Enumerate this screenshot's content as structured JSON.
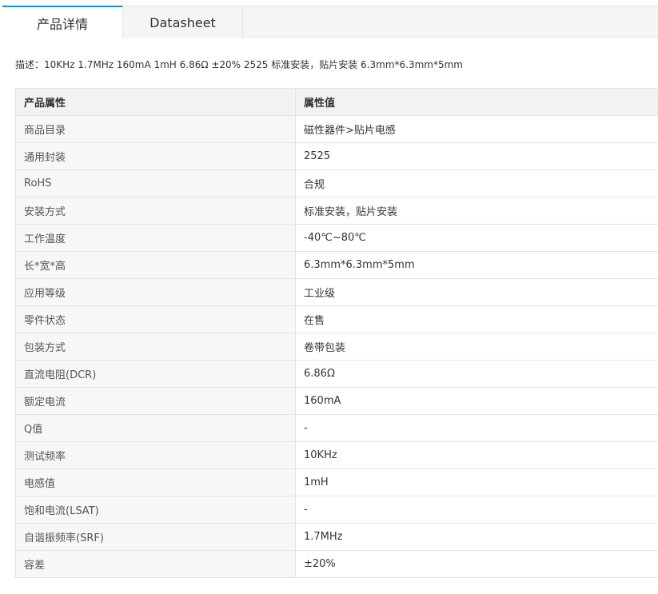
{
  "tabs": [
    {
      "label": "产品详情",
      "active": true
    },
    {
      "label": "Datasheet",
      "active": false
    }
  ],
  "description": "描述：10KHz 1.7MHz 160mA 1mH 6.86Ω ±20% 2525 标准安装，贴片安装 6.3mm*6.3mm*5mm",
  "table": {
    "headers": [
      "产品属性",
      "属性值"
    ],
    "rows": [
      {
        "name": "商品目录",
        "value": "磁性器件>贴片电感"
      },
      {
        "name": "通用封装",
        "value": "2525"
      },
      {
        "name": "RoHS",
        "value": "合规"
      },
      {
        "name": "安装方式",
        "value": "标准安装，贴片安装"
      },
      {
        "name": "工作温度",
        "value": "-40℃~80℃"
      },
      {
        "name": "长*宽*高",
        "value": "6.3mm*6.3mm*5mm"
      },
      {
        "name": "应用等级",
        "value": "工业级"
      },
      {
        "name": "零件状态",
        "value": "在售"
      },
      {
        "name": "包装方式",
        "value": "卷带包装"
      },
      {
        "name": "直流电阻(DCR)",
        "value": "6.86Ω"
      },
      {
        "name": "额定电流",
        "value": "160mA"
      },
      {
        "name": "Q值",
        "value": "-"
      },
      {
        "name": "测试频率",
        "value": "10KHz"
      },
      {
        "name": "电感值",
        "value": "1mH"
      },
      {
        "name": "饱和电流(LSAT)",
        "value": "-"
      },
      {
        "name": "自谐振频率(SRF)",
        "value": "1.7MHz"
      },
      {
        "name": "容差",
        "value": "±20%"
      }
    ]
  },
  "colors": {
    "accent": "#1c8fd6",
    "border": "#e4e4e4",
    "header_bg": "#f2f2f2",
    "label_bg": "#f7f7f7"
  }
}
